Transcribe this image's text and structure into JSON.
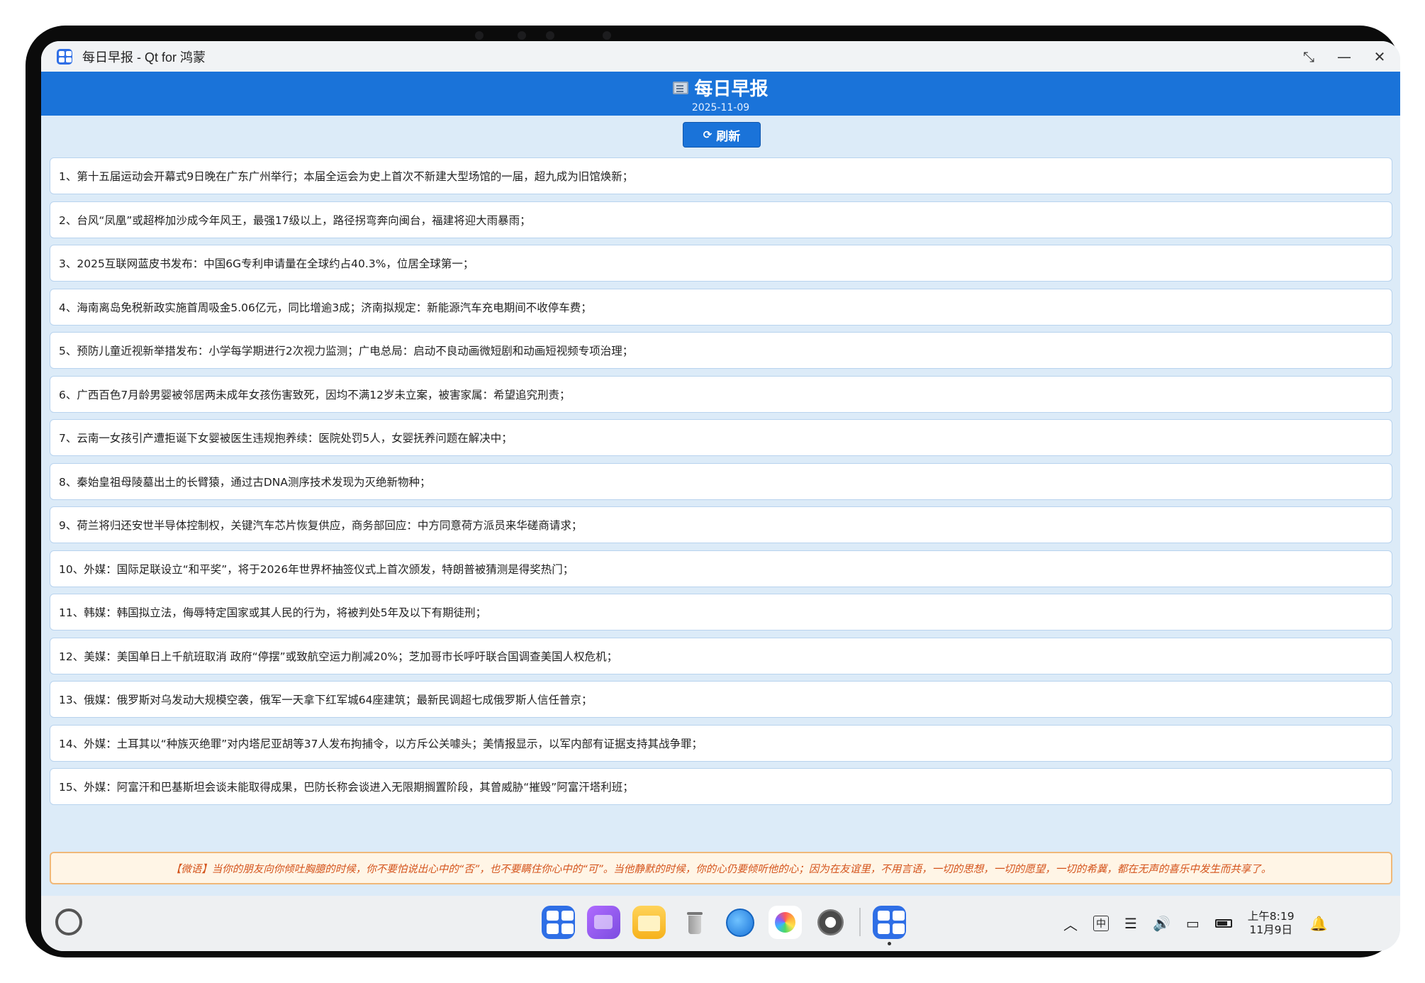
{
  "window": {
    "title": "每日早报 - Qt for 鸿蒙",
    "restore_glyph": "⤡",
    "minimize_glyph": "—",
    "close_glyph": "✕"
  },
  "header": {
    "title": "每日早报",
    "date": "2025-11-09"
  },
  "toolbar": {
    "refresh_label": "刷新",
    "refresh_icon": "⟳"
  },
  "news": [
    "1、第十五届运动会开幕式9日晚在广东广州举行；本届全运会为史上首次不新建大型场馆的一届，超九成为旧馆焕新；",
    "2、台风“凤凰”或超桦加沙成今年风王，最强17级以上，路径拐弯奔向闽台，福建将迎大雨暴雨；",
    "3、2025互联网蓝皮书发布：中国6G专利申请量在全球约占40.3%，位居全球第一；",
    "4、海南离岛免税新政实施首周吸金5.06亿元，同比增逾3成；济南拟规定：新能源汽车充电期间不收停车费；",
    "5、预防儿童近视新举措发布：小学每学期进行2次视力监测；广电总局：启动不良动画微短剧和动画短视频专项治理；",
    "6、广西百色7月龄男婴被邻居两未成年女孩伤害致死，因均不满12岁未立案，被害家属：希望追究刑责；",
    "7、云南一女孩引产遭拒诞下女婴被医生违规抱养续：医院处罚5人，女婴抚养问题在解决中；",
    "8、秦始皇祖母陵墓出土的长臂猿，通过古DNA测序技术发现为灭绝新物种；",
    "9、荷兰将归还安世半导体控制权，关键汽车芯片恢复供应，商务部回应：中方同意荷方派员来华磋商请求；",
    "10、外媒：国际足联设立“和平奖”，将于2026年世界杯抽签仪式上首次颁发，特朗普被猜测是得奖热门；",
    "11、韩媒：韩国拟立法，侮辱特定国家或其人民的行为，将被判处5年及以下有期徒刑；",
    "12、美媒：美国单日上千航班取消 政府“停摆”或致航空运力削减20%；芝加哥市长呼吁联合国调查美国人权危机；",
    "13、俄媒：俄罗斯对乌发动大规模空袭，俄军一天拿下红军城64座建筑；最新民调超七成俄罗斯人信任普京；",
    "14、外媒：土耳其以“种族灭绝罪”对内塔尼亚胡等37人发布拘捕令，以方斥公关噱头；美情报显示，以军内部有证据支持其战争罪；",
    "15、外媒：阿富汗和巴基斯坦会谈未能取得成果，巴防长称会谈进入无限期搁置阶段，其曾威胁“摧毁”阿富汗塔利班；"
  ],
  "quote": "【微语】当你的朋友向你倾吐胸臆的时候，你不要怕说出心中的“否”，也不要瞒住你心中的“可”。当他静默的时候，你的心仍要倾听他的心；因为在友谊里，不用言语，一切的思想，一切的愿望，一切的希冀，都在无声的喜乐中发生而共享了。",
  "taskbar": {
    "ime_label": "中",
    "chevron_glyph": "︿",
    "clipboard_glyph": "☰",
    "volume_glyph": "🔊",
    "display_glyph": "▭",
    "bell_glyph": "🔔",
    "clock_time": "上午8:19",
    "clock_date": "11月9日"
  },
  "colors": {
    "header_blue": "#1a73d9",
    "quote_text": "#d4541c",
    "quote_border": "#f0b878",
    "background": "#dcebf8"
  }
}
